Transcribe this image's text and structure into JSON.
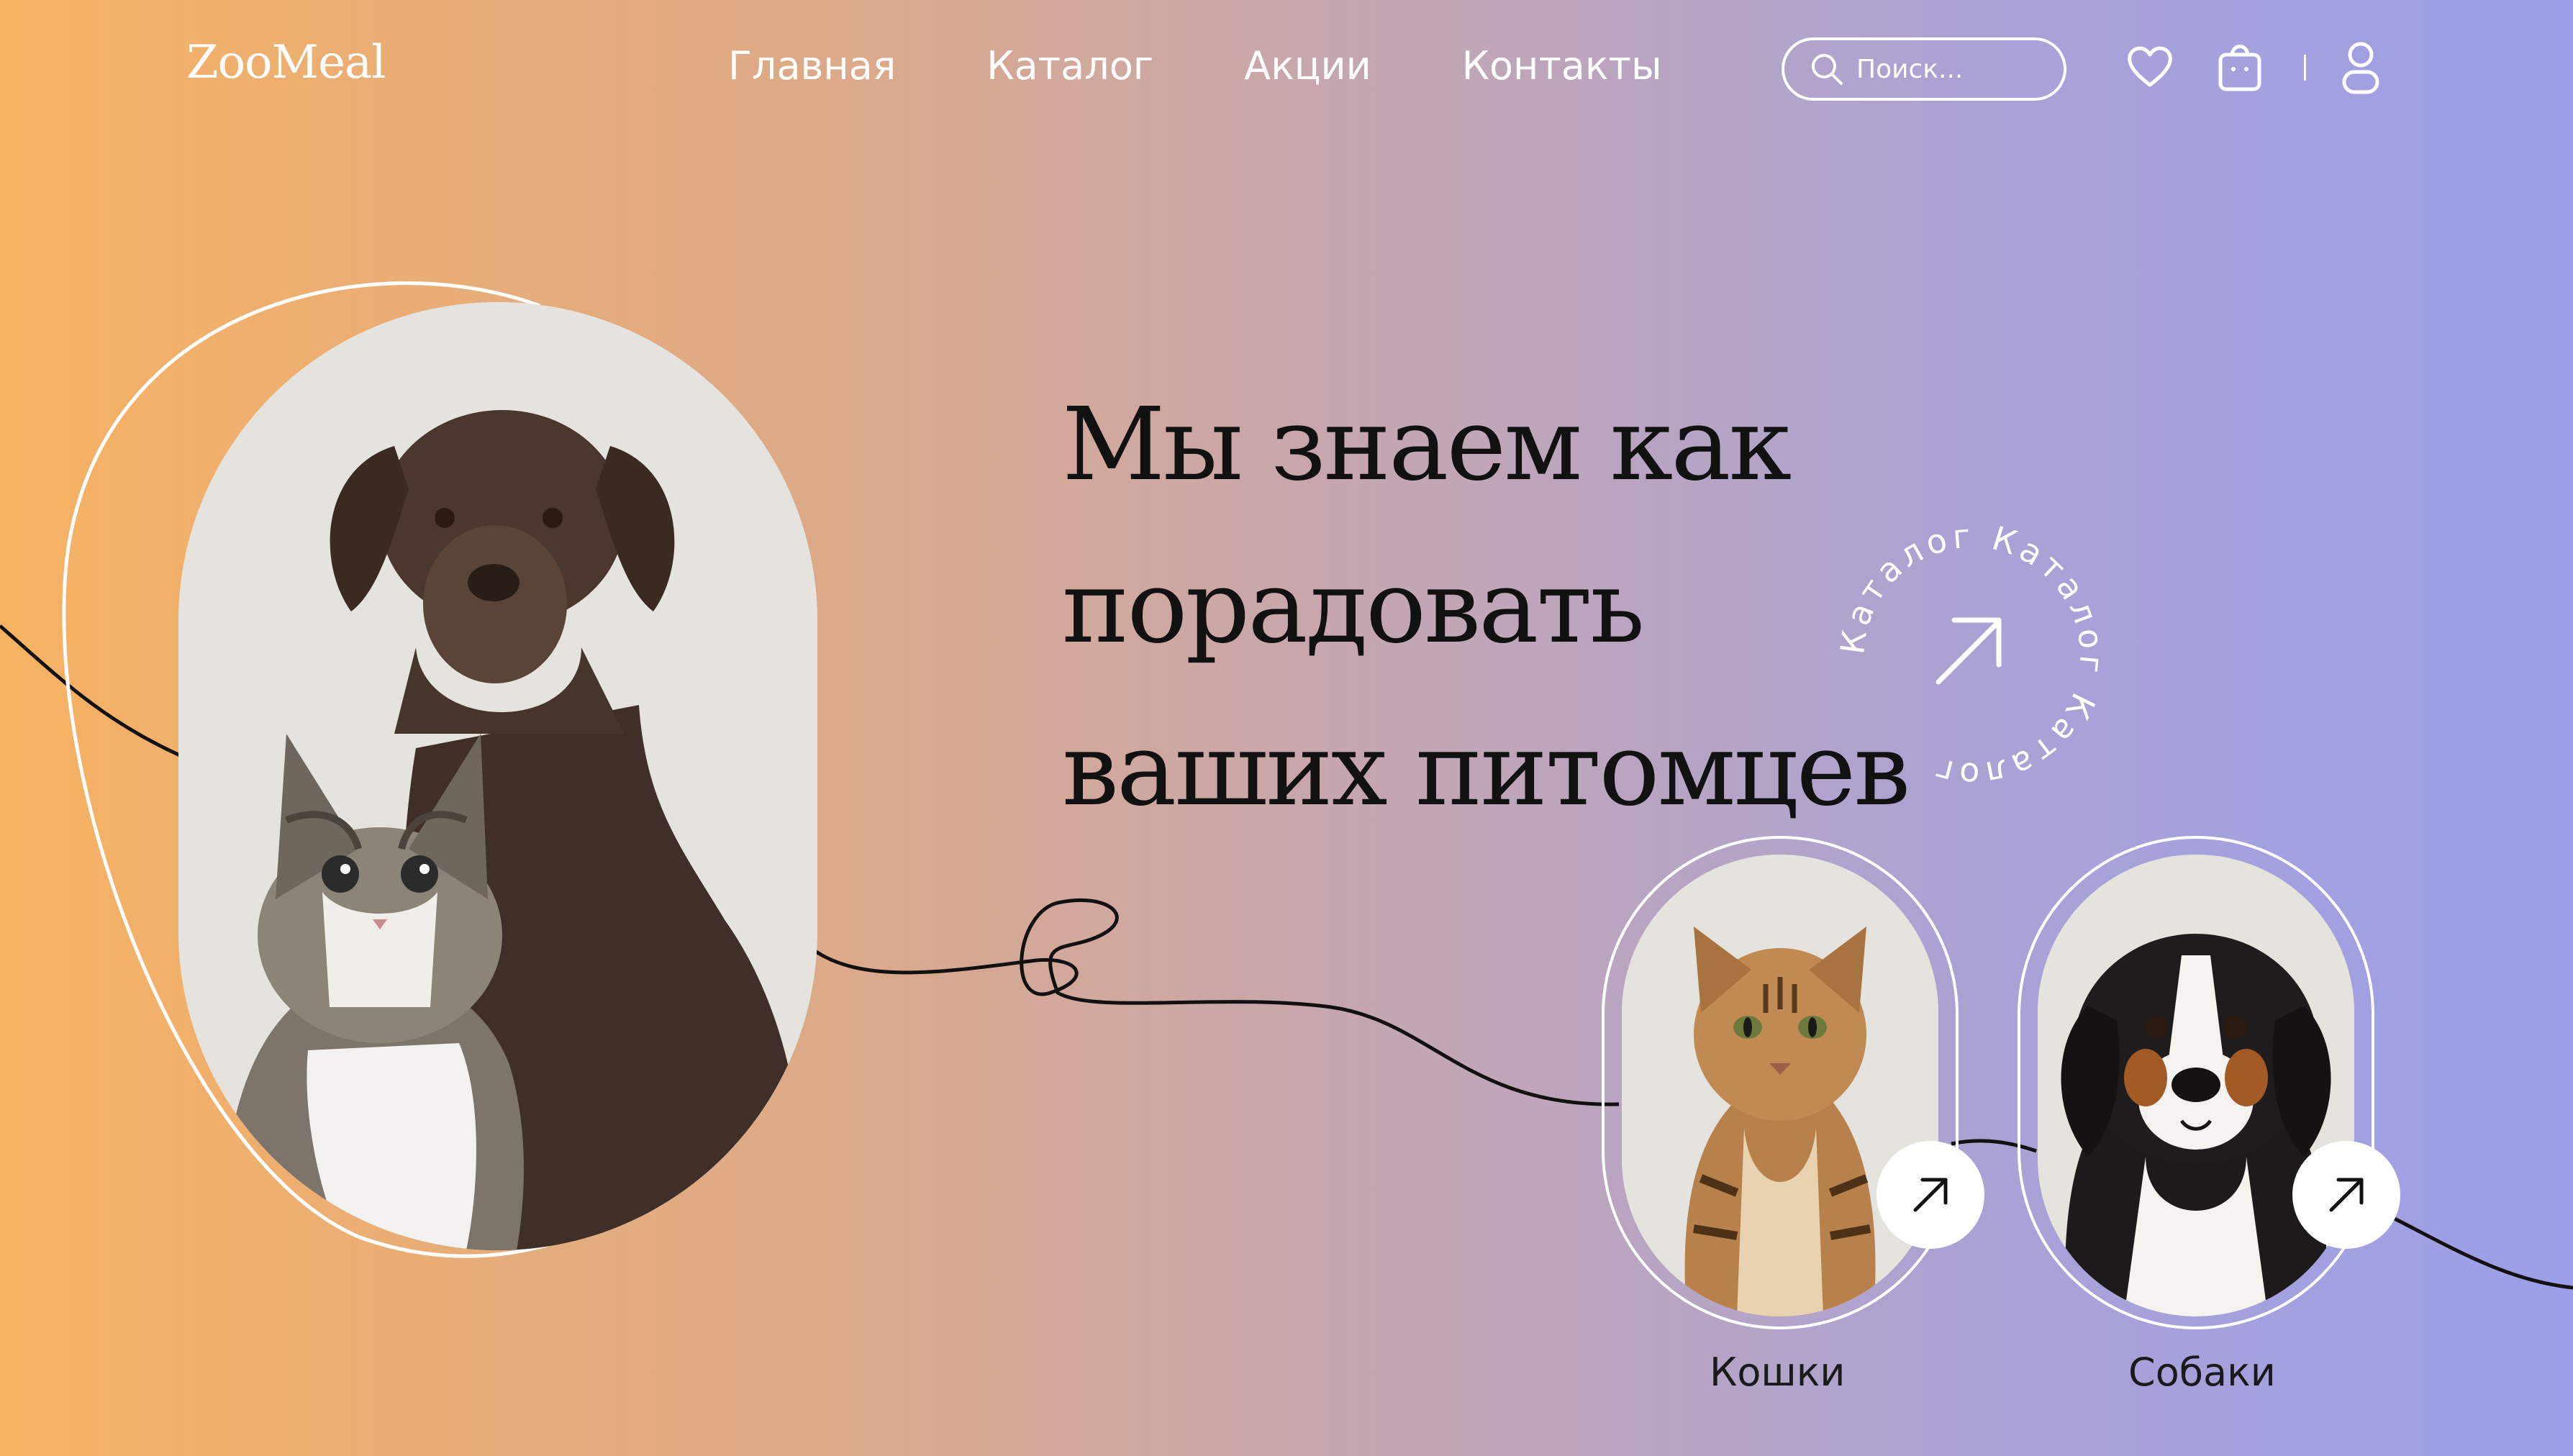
{
  "header": {
    "logo": "ZooMeal",
    "nav": [
      "Главная",
      "Каталог",
      "Акции",
      "Контакты"
    ],
    "search_placeholder": "Поиск..."
  },
  "icons": {
    "search": "search-icon",
    "favorites": "heart-icon",
    "cart": "shopping-bag-icon",
    "profile": "user-icon",
    "arrow": "arrow-up-right-icon"
  },
  "hero": {
    "title_line1": "Мы знаем как порадовать",
    "title_line2": "ваших питомцев",
    "circular_link_text": "Каталог Каталог Каталог "
  },
  "categories": [
    {
      "label": "Кошки"
    },
    {
      "label": "Собаки"
    }
  ],
  "colors": {
    "gradient_start": "#f7b262",
    "gradient_end": "#9c9fe8",
    "text_dark": "#111111",
    "white": "#ffffff"
  }
}
